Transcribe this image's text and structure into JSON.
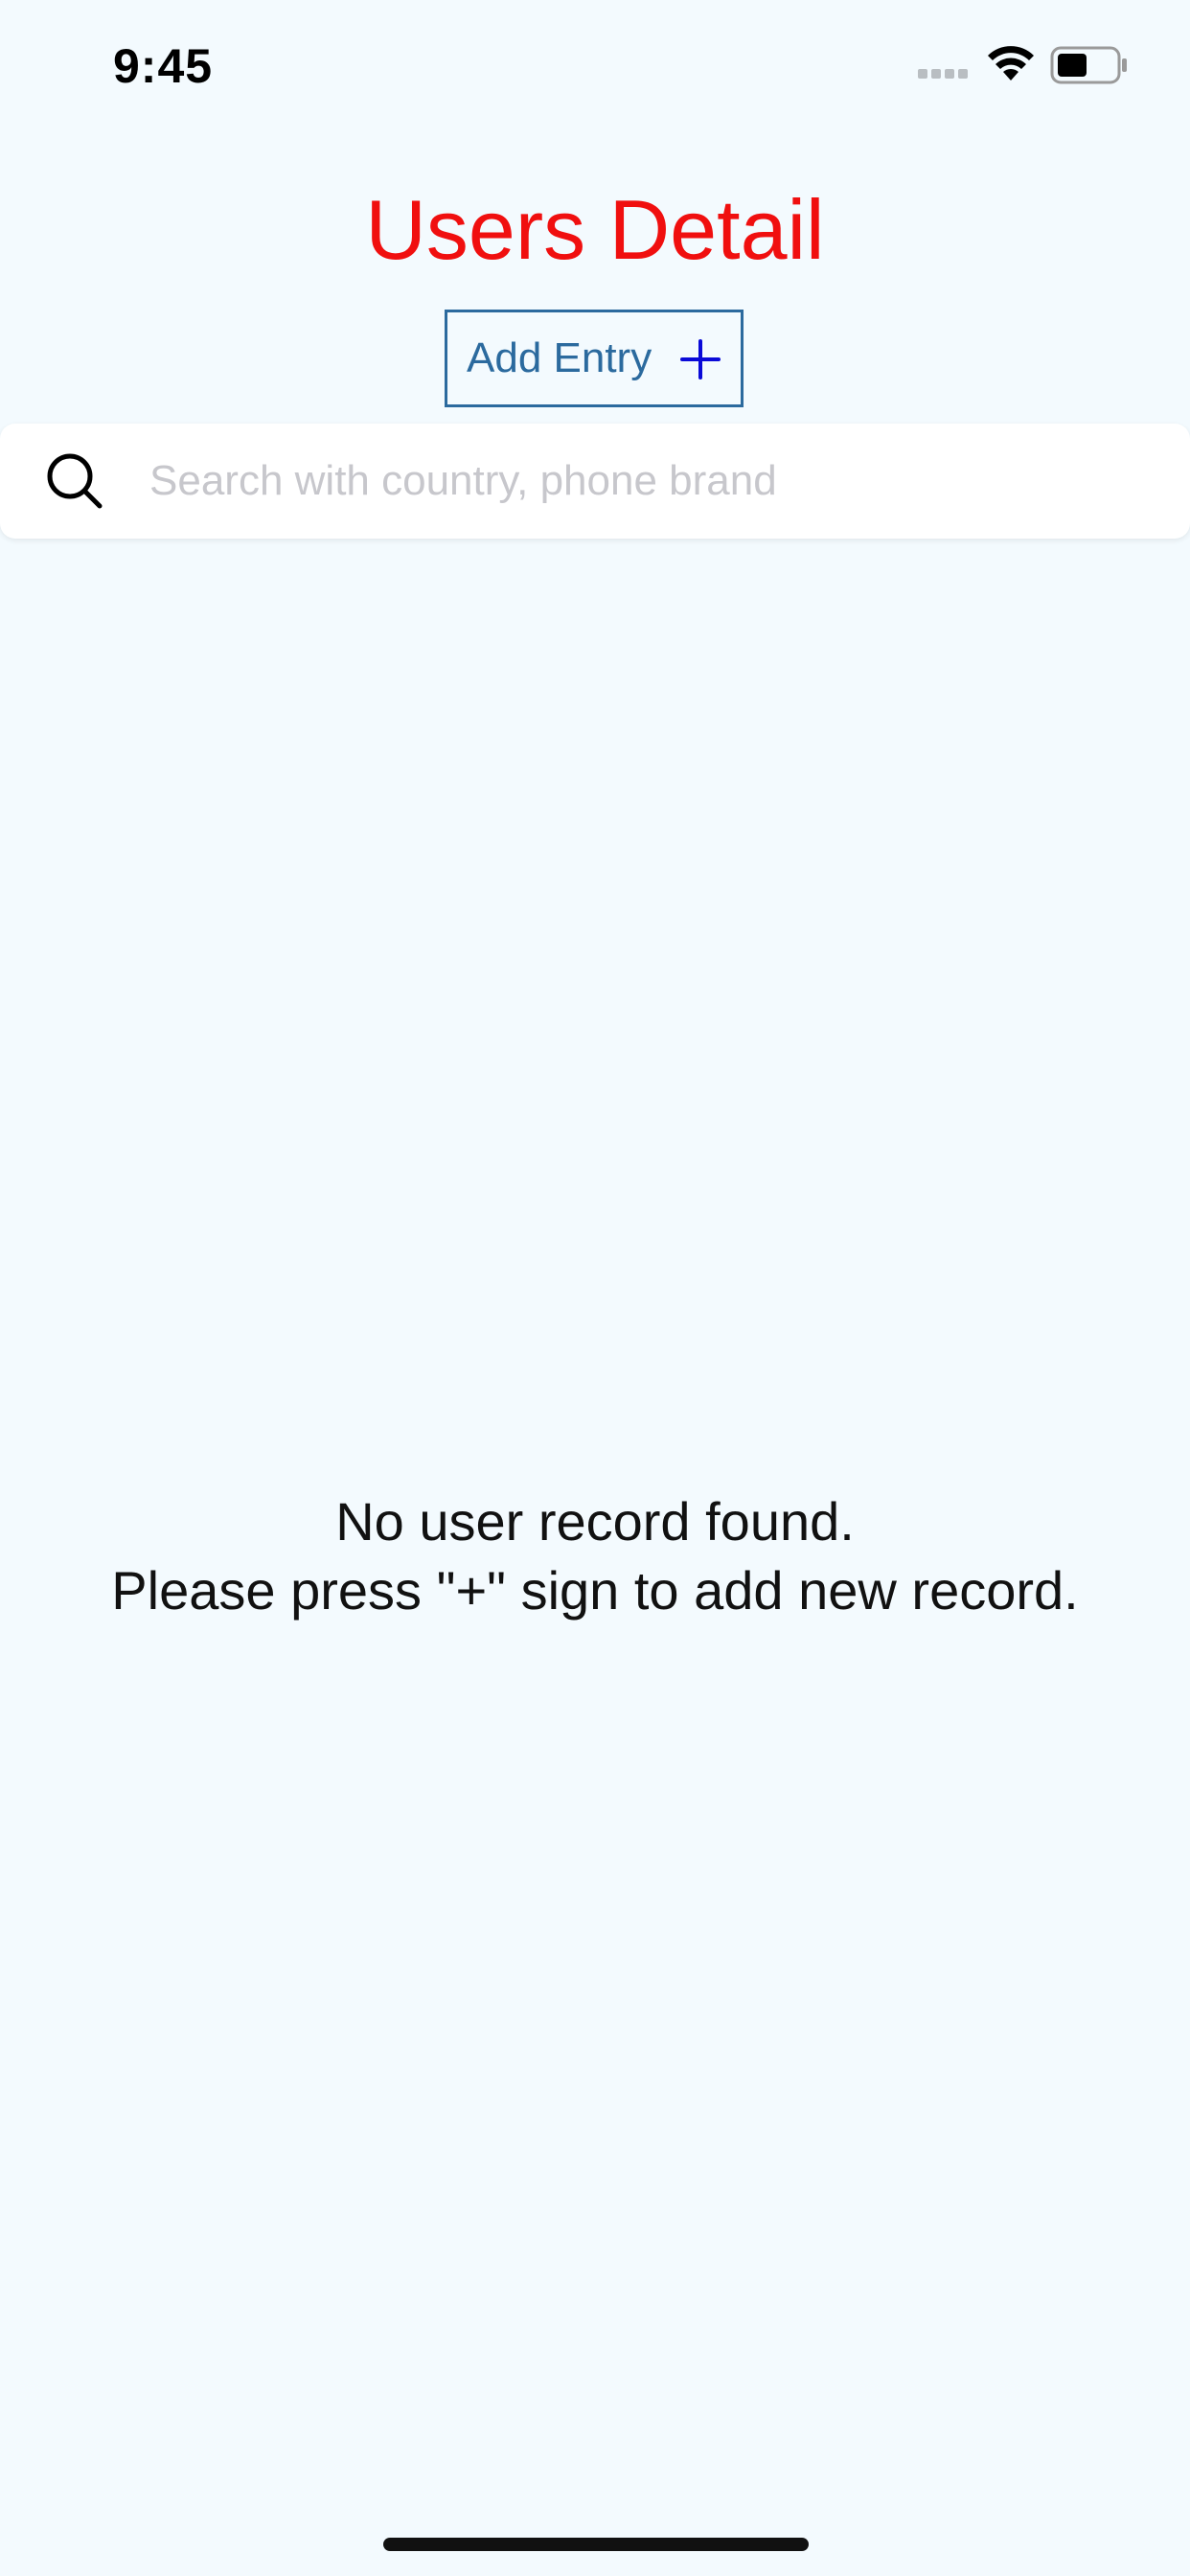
{
  "status_bar": {
    "time": "9:45",
    "icons": [
      "signal-icon",
      "wifi-icon",
      "battery-icon"
    ]
  },
  "header": {
    "title": "Users Detail",
    "title_color": "#F00F0F"
  },
  "toolbar": {
    "add_entry_label": "Add Entry",
    "add_entry_icon": "plus-icon",
    "accent_color": "#2B6A9E",
    "plus_color": "#0A0AD8"
  },
  "search": {
    "placeholder": "Search with country, phone brand",
    "value": ""
  },
  "empty_state": {
    "line1": "No user record found.",
    "line2": "Please press \"+\" sign to add new record."
  },
  "theme": {
    "background": "#F3FAFE"
  }
}
